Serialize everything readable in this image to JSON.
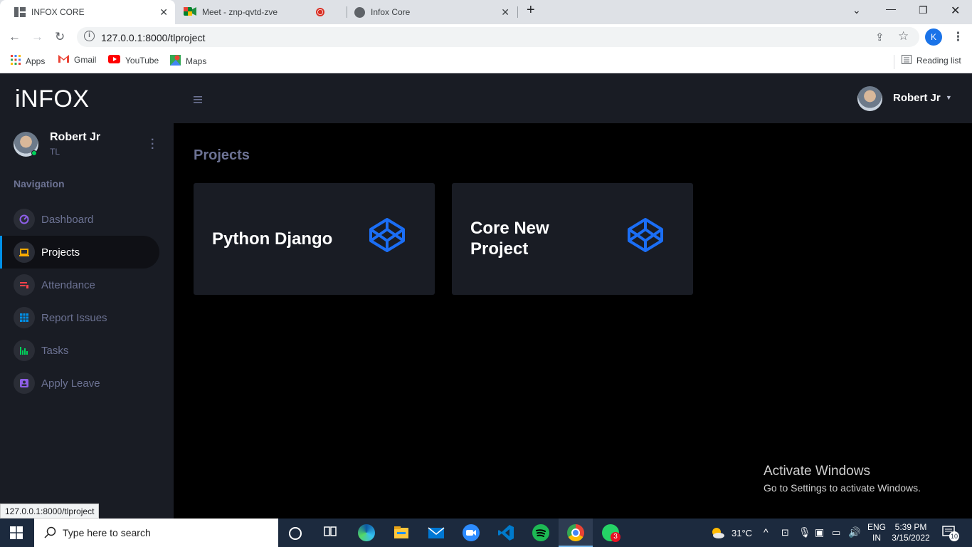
{
  "browser": {
    "tabs": [
      {
        "title": "INFOX CORE",
        "active": true
      },
      {
        "title": "Meet - znp-qvtd-zve",
        "active": false
      },
      {
        "title": "Infox Core",
        "active": false
      }
    ],
    "url": "127.0.0.1:8000/tlproject",
    "profile_initial": "K",
    "bookmarks": [
      "Apps",
      "Gmail",
      "YouTube",
      "Maps"
    ],
    "reading_list": "Reading list",
    "status_url": "127.0.0.1:8000/tlproject"
  },
  "app": {
    "brand": "iNFOX",
    "user": {
      "name": "Robert Jr",
      "role": "TL"
    },
    "nav_heading": "Navigation",
    "nav_items": [
      {
        "label": "Dashboard",
        "icon": "speedometer-icon",
        "color": "#8f5fe8"
      },
      {
        "label": "Projects",
        "icon": "laptop-icon",
        "color": "#ffab00"
      },
      {
        "label": "Attendance",
        "icon": "playlist-icon",
        "color": "#fc424a"
      },
      {
        "label": "Report Issues",
        "icon": "table-icon",
        "color": "#0090e7"
      },
      {
        "label": "Tasks",
        "icon": "chart-bar-icon",
        "color": "#00d25b"
      },
      {
        "label": "Apply Leave",
        "icon": "contacts-icon",
        "color": "#8f5fe8"
      }
    ],
    "active_nav": "Projects",
    "topbar_user": "Robert Jr",
    "page_title": "Projects",
    "projects": [
      {
        "title": "Python Django"
      },
      {
        "title": "Core New Project"
      }
    ],
    "accent": "#0090e7",
    "card_icon_color": "#1b6ef5"
  },
  "watermark": {
    "line1": "Activate Windows",
    "line2": "Go to Settings to activate Windows."
  },
  "taskbar": {
    "search_placeholder": "Type here to search",
    "weather": "31°C",
    "lang": "ENG",
    "region": "IN",
    "time": "5:39 PM",
    "date": "3/15/2022",
    "whatsapp_badge": "3",
    "notif_count": "10"
  }
}
